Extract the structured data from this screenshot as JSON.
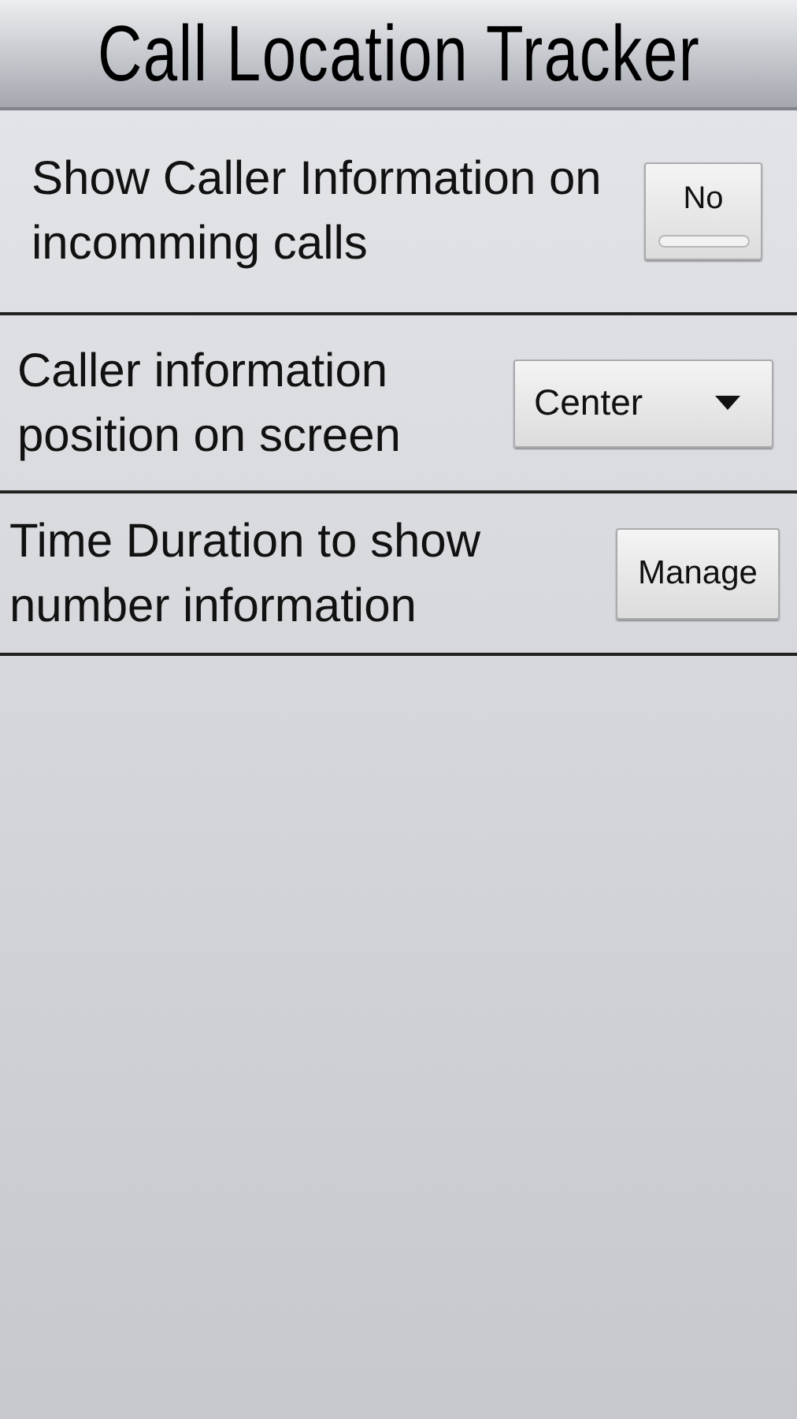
{
  "title": "Call Location Tracker",
  "settings": [
    {
      "kind": "toggle",
      "label": "Show Caller Information on incomming calls",
      "control": "No",
      "on": false
    },
    {
      "kind": "dropdown",
      "label": "Caller information position on screen",
      "control": "Center"
    },
    {
      "kind": "button",
      "label": "Time Duration to show number information",
      "control": "Manage"
    }
  ]
}
